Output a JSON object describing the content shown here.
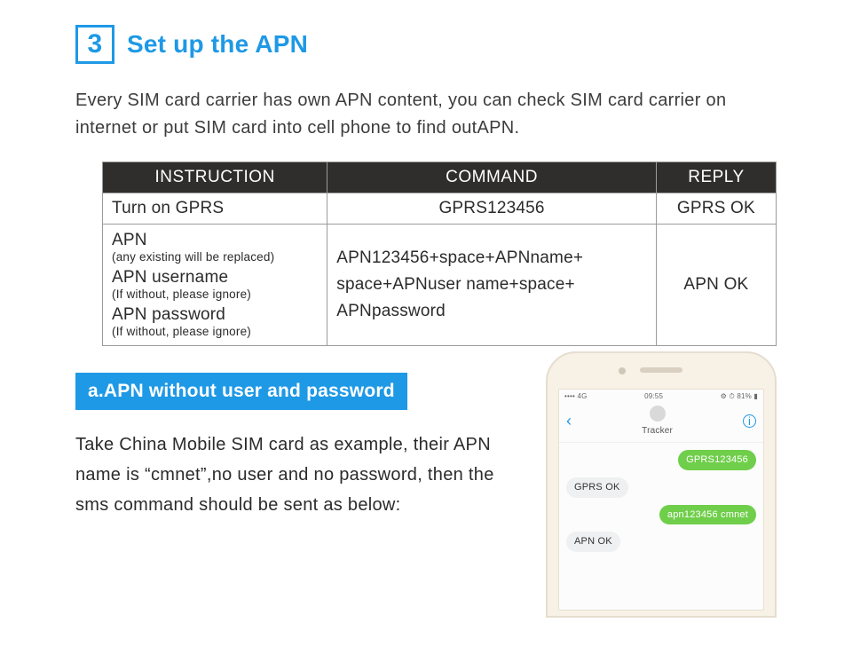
{
  "step": {
    "number": "3",
    "title": "Set up the APN"
  },
  "intro": "Every SIM card carrier has own APN content, you can check SIM card carrier on internet or put SIM card into cell phone to find outAPN.",
  "table": {
    "headers": {
      "h1": "INSTRUCTION",
      "h2": "COMMAND",
      "h3": "REPLY"
    },
    "row1": {
      "instruction": "Turn on GPRS",
      "command": "GPRS123456",
      "reply": "GPRS OK"
    },
    "row2": {
      "inst1": "APN",
      "sub1": "(any existing will be replaced)",
      "inst2": "APN username",
      "sub2": "(If without, please ignore)",
      "inst3": "APN password",
      "sub3": "(If without, please ignore)",
      "cmd_l1": "APN123456+space+APNname+",
      "cmd_l2": "space+APNuser name+space+",
      "cmd_l3": "APNpassword",
      "reply": "APN OK"
    }
  },
  "section_a": {
    "header": "a.APN without user and password",
    "desc": "Take China Mobile SIM card as example, their APN name is “cmnet”,no user and no password, then the sms command should be sent as below:"
  },
  "phone": {
    "status": {
      "carrier": "4G",
      "time": "09:55",
      "battery": "81%"
    },
    "nav": {
      "title": "Tracker",
      "info": "i"
    },
    "messages": {
      "m1": "GPRS123456",
      "m2": "GPRS OK",
      "m3": "apn123456 cmnet",
      "m4": "APN OK"
    }
  }
}
